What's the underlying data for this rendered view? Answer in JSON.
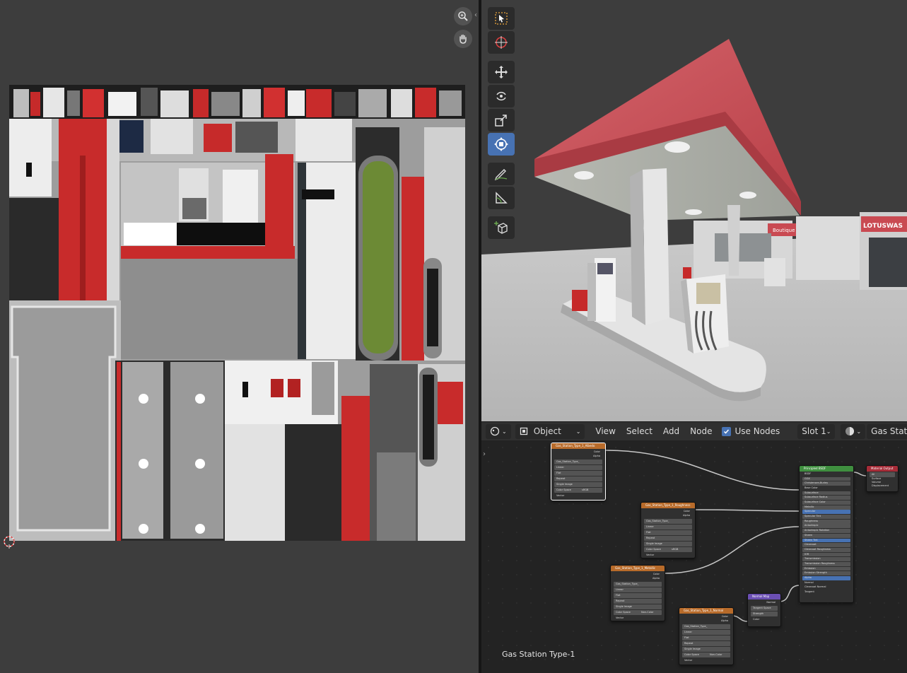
{
  "node_editor": {
    "header": {
      "editor_type_icon": "node-editor-icon",
      "object_mode": "Object",
      "menus": [
        "View",
        "Select",
        "Add",
        "Node"
      ],
      "use_nodes_label": "Use Nodes",
      "slot": "Slot 1",
      "material_name": "Gas Station Ty"
    },
    "tree_name": "Gas Station Type-1",
    "nodes": {
      "image_base_color": {
        "title": "Gas_Station_Type_1_Albedo",
        "outputs": [
          "Color",
          "Alpha"
        ],
        "image": "Gas_Station_Type_",
        "rows": [
          "Linear",
          "Flat",
          "Repeat",
          "Single Image",
          "Color Space",
          "sRGB",
          "Vector"
        ]
      },
      "image_roughness": {
        "title": "Gas_Station_Type_1_Roughness",
        "outputs": [
          "Color",
          "Alpha"
        ],
        "image": "Gas_Station_Type_",
        "rows": [
          "Linear",
          "Flat",
          "Repeat",
          "Single Image",
          "Color Space",
          "sRGB",
          "Vector"
        ]
      },
      "image_metallic": {
        "title": "Gas_Station_Type_1_Metallic",
        "outputs": [
          "Color",
          "Alpha"
        ],
        "image": "Gas_Station_Type_",
        "rows": [
          "Linear",
          "Flat",
          "Repeat",
          "Single Image",
          "Color Space",
          "Non-Color",
          "Vector"
        ]
      },
      "image_normal": {
        "title": "Gas_Station_Type_1_Normal",
        "outputs": [
          "Color",
          "Alpha"
        ],
        "image": "Gas_Station_Type_",
        "rows": [
          "Linear",
          "Flat",
          "Repeat",
          "Single Image",
          "Color Space",
          "Non-Color",
          "Vector"
        ]
      },
      "normal_map": {
        "title": "Normal Map",
        "rows": [
          "Normal",
          "Tangent Space",
          "Strength",
          "Color"
        ]
      },
      "principled_bsdf": {
        "title": "Principled BSDF",
        "rows": [
          "BSDF",
          "GGX",
          "Christensen-Burley",
          "Base Color",
          "Subsurface",
          "Subsurface Radius",
          "Subsurface Color",
          "Metallic",
          "Specular",
          "Specular Tint",
          "Roughness",
          "Anisotropic",
          "Anisotropic Rotation",
          "Sheen",
          "Sheen Tint",
          "Clearcoat",
          "Clearcoat Roughness",
          "IOR",
          "Transmission",
          "Transmission Roughness",
          "Emission",
          "Emission Strength",
          "Alpha",
          "Normal",
          "Clearcoat Normal",
          "Tangent"
        ]
      },
      "material_output": {
        "title": "Material Output",
        "rows": [
          "All",
          "Surface",
          "Volume",
          "Displacement"
        ]
      }
    }
  },
  "viewport": {
    "signs": {
      "boutique": "Boutique",
      "carwash": "LOTUSWAS"
    }
  },
  "colors": {
    "accent_blue": "#4772b3",
    "canopy_red": "#c94a52",
    "texture_red": "#c82b2b",
    "node_image_header": "#b86b2a",
    "node_shader_header": "#3f8f3f",
    "node_output_header": "#a62c38",
    "node_vector_header": "#6b4fb3"
  }
}
